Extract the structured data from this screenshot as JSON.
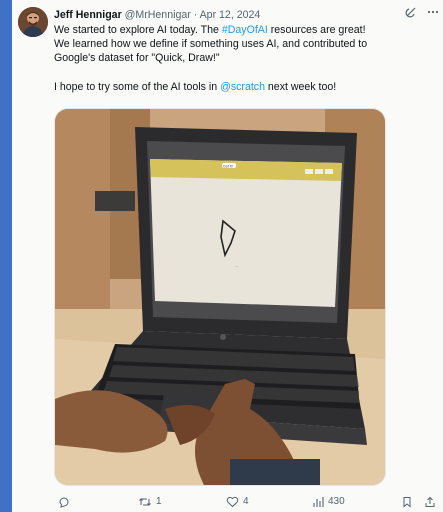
{
  "tweet": {
    "author_name": "Jeff Hennigar",
    "author_handle": "@MrHennigar",
    "separator": "·",
    "date": "Apr 12, 2024",
    "text": {
      "l1_a": "We started to explore AI today. The ",
      "hashtag": "#DayOfAI",
      "l1_b": " resources are great!",
      "l2": "We learned how we define if something uses AI, and contributed to",
      "l3": "Google's dataset for \"Quick, Draw!\"",
      "l4_a": "I hope to try some of the AI tools in ",
      "mention": "@scratch",
      "l4_b": " next week too!"
    },
    "header_icons": [
      "grok-icon",
      "more-icon"
    ],
    "media": {
      "laptop_screen_label": "Got it!",
      "drawing_caption": "..."
    },
    "actions": {
      "replies": "",
      "retweets": "1",
      "likes": "4",
      "views": "430"
    },
    "colors": {
      "page_background": "#3d72c4",
      "link": "#1d9bf0",
      "text": "#0f1419",
      "muted": "#536471"
    }
  }
}
